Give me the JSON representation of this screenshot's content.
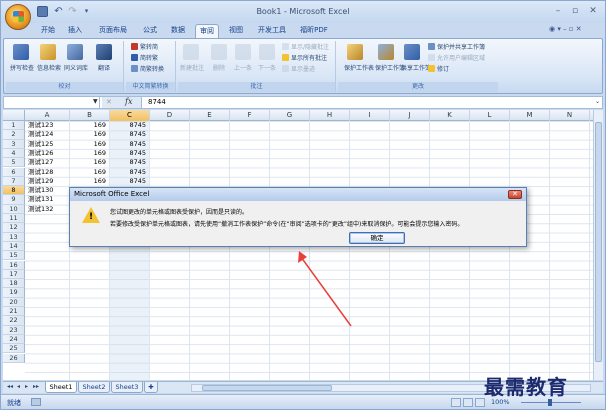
{
  "window": {
    "title": "Book1 - Microsoft Excel",
    "controls": {
      "minimize": "–",
      "maximize": "▫",
      "close": "✕"
    }
  },
  "quick_access": {
    "undo": "↶",
    "redo": "↷",
    "more": "▾"
  },
  "tabs": [
    {
      "label": "开始",
      "active": false
    },
    {
      "label": "插入",
      "active": false
    },
    {
      "label": "页面布局",
      "active": false
    },
    {
      "label": "公式",
      "active": false
    },
    {
      "label": "数据",
      "active": false
    },
    {
      "label": "审阅",
      "active": true
    },
    {
      "label": "视图",
      "active": false
    },
    {
      "label": "开发工具",
      "active": false
    },
    {
      "label": "福昕PDF",
      "active": false
    }
  ],
  "help_area": "◉ ▾ – ▫ ✕",
  "ribbon": {
    "groups": [
      {
        "label": "校对",
        "buttons": [
          "拼写检查",
          "信息检索",
          "同义词库",
          "翻译"
        ]
      },
      {
        "label": "中文简繁转换",
        "buttons": [
          "繁转简",
          "简转繁",
          "简繁转换"
        ]
      },
      {
        "label": "批注",
        "buttons": [
          "新建批注",
          "删除",
          "上一条",
          "下一条"
        ],
        "small": [
          "显示/隐藏批注",
          "显示所有批注",
          "显示墨迹"
        ]
      },
      {
        "label": "更改",
        "buttons": [
          "保护工作表",
          "保护工作簿",
          "共享工作簿"
        ],
        "small": [
          "保护并共享工作簿",
          "允许用户编辑区域",
          "修订"
        ]
      }
    ]
  },
  "formula_bar": {
    "name_box": "",
    "cancel": "✕",
    "fx": "fx",
    "value": "8744",
    "expand": "⌄"
  },
  "grid": {
    "columns": [
      "A",
      "B",
      "C",
      "D",
      "E",
      "F",
      "G",
      "H",
      "I",
      "J",
      "K",
      "L",
      "M",
      "N"
    ],
    "selected_column": "C",
    "row_count": 26,
    "selected_row": 8,
    "rows": [
      [
        "测试123",
        "169",
        "8745"
      ],
      [
        "测试124",
        "169",
        "8745"
      ],
      [
        "测试125",
        "169",
        "8745"
      ],
      [
        "测试126",
        "169",
        "8745"
      ],
      [
        "测试127",
        "169",
        "8745"
      ],
      [
        "测试128",
        "169",
        "8745"
      ],
      [
        "测试129",
        "169",
        "8745"
      ],
      [
        "测试130",
        "",
        ""
      ],
      [
        "测试131",
        "",
        ""
      ],
      [
        "测试132",
        "",
        ""
      ]
    ]
  },
  "sheets": [
    {
      "label": "Sheet1",
      "active": true
    },
    {
      "label": "Sheet2",
      "active": false
    },
    {
      "label": "Sheet3",
      "active": false
    }
  ],
  "sheet_nav": [
    "◂◂",
    "◂",
    "▸",
    "▸▸"
  ],
  "status": {
    "mode": "就绪",
    "zoom": "100%"
  },
  "dialog": {
    "title": "Microsoft Office Excel",
    "message_line1": "您试图更改的单元格或图表受保护，因而是只读的。",
    "message_line2": "若要修改受保护单元格或图表，请先使用“撤消工作表保护”命令(在“审阅”选项卡的“更改”组中)来取消保护。可能会提示您输入密码。",
    "ok_label": "确定",
    "close": "✕",
    "warn_mark": "!"
  },
  "watermark": "最需教育",
  "colors": {
    "accent": "#15428b",
    "ribbon_bg": "#dbe8f8",
    "selection": "#f1c15f",
    "arrow": "#e8413c",
    "warning": "#f2c230"
  }
}
